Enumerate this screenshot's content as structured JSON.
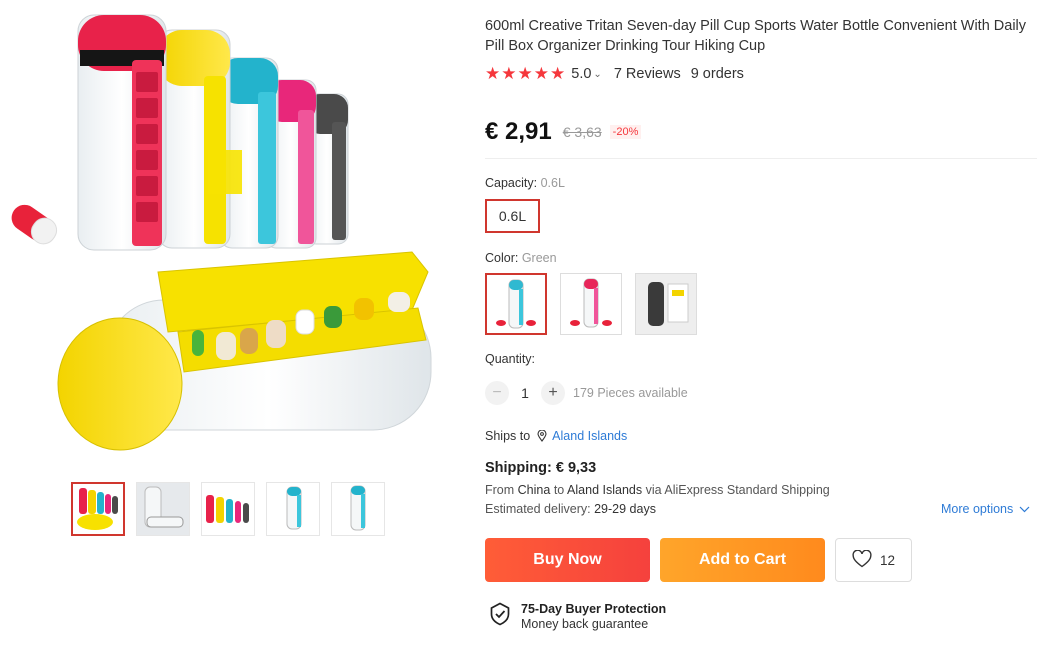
{
  "product": {
    "title": "600ml Creative Tritan Seven-day Pill Cup Sports Water Bottle Convenient With Daily Pill Box Organizer Drinking Tour Hiking Cup",
    "rating": "5.0",
    "reviews": "7 Reviews",
    "orders": "9 orders",
    "price": "€ 2,91",
    "old_price": "€ 3,63",
    "discount": "-20%"
  },
  "capacity": {
    "label": "Capacity:",
    "selected": "0.6L",
    "options": [
      "0.6L"
    ]
  },
  "color": {
    "label": "Color:",
    "selected": "Green",
    "swatch_colors": [
      "#2fb9d1",
      "#e8265a",
      "#3a3a3a"
    ]
  },
  "quantity": {
    "label": "Quantity:",
    "minus": "−",
    "value": "1",
    "plus": "+",
    "available": "179 Pieces available"
  },
  "ships": {
    "label": "Ships to",
    "destination": "Aland Islands"
  },
  "shipping": {
    "title": "Shipping: € 9,33",
    "from_prefix": "From",
    "from": "China",
    "to_word": "to",
    "to": "Aland Islands",
    "via": "via AliExpress Standard Shipping",
    "estimated_label": "Estimated delivery:",
    "estimated_value": "29-29 days",
    "more_options": "More options"
  },
  "actions": {
    "buy_now": "Buy Now",
    "add_to_cart": "Add to Cart",
    "wishlist_count": "12"
  },
  "protection": {
    "title": "75-Day Buyer Protection",
    "subtitle": "Money back guarantee"
  },
  "colors": {
    "accent_red": "#d0362e",
    "buy_now": "#f5413d",
    "add_to_cart": "#ff9a22",
    "link": "#2e7bd6",
    "star": "#f5373c"
  }
}
